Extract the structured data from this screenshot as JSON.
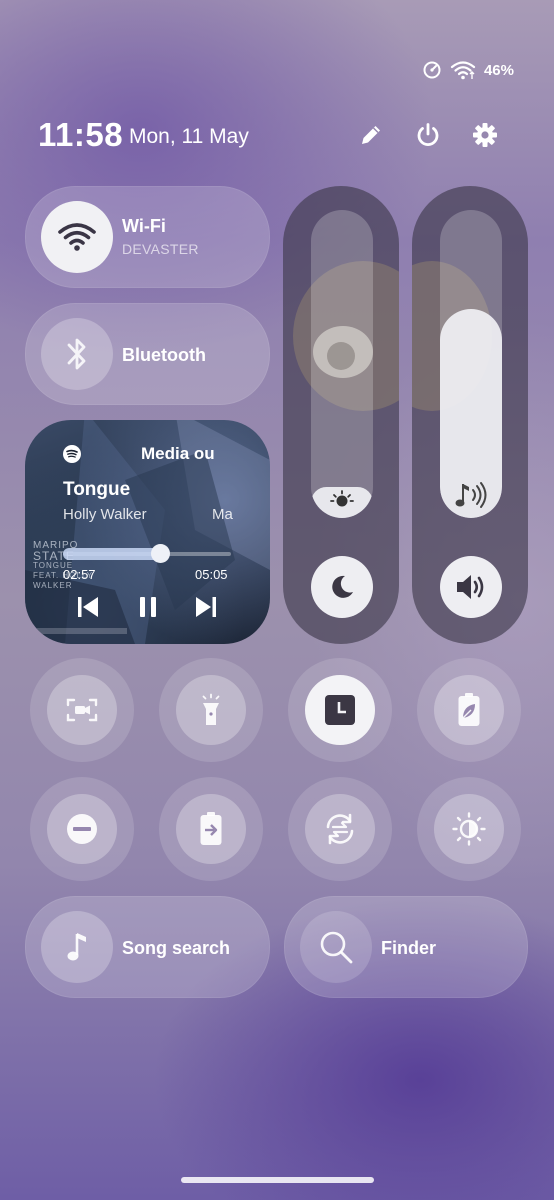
{
  "status_bar": {
    "battery_percent": "46%",
    "icons": [
      "data-saver-icon",
      "wifi-signal-icon"
    ]
  },
  "header": {
    "time": "11:58",
    "date": "Mon, 11 May",
    "icons": [
      "edit-icon",
      "power-icon",
      "settings-icon"
    ]
  },
  "tiles": {
    "wifi": {
      "title": "Wi-Fi",
      "subtitle": "DEVASTER",
      "icon": "wifi-icon",
      "active": true
    },
    "bluetooth": {
      "title": "Bluetooth",
      "icon": "bluetooth-icon",
      "active": false
    },
    "song_search": {
      "title": "Song search",
      "icon": "music-note-icon"
    },
    "finder": {
      "title": "Finder",
      "icon": "search-icon"
    }
  },
  "media": {
    "app_icon": "spotify-icon",
    "output_label": "Media ou",
    "track_title": "Tongue",
    "artist": "Holly Walker",
    "artist_overflow": "Ma",
    "elapsed": "02:57",
    "duration": "05:05",
    "progress": 0.58,
    "art_text": [
      "MARIPO",
      "STATE",
      "TONGUE",
      "FEAT. HOLLY",
      "WALKER"
    ]
  },
  "sliders": {
    "brightness": {
      "level": 0.1,
      "icon": "brightness-icon",
      "button_icon": "night-mode-icon"
    },
    "volume": {
      "level": 0.68,
      "icon": "volume-music-icon",
      "button_icon": "sound-on-icon"
    }
  },
  "quick_toggles": [
    {
      "name": "screen-recorder",
      "icon": "screen-record-icon",
      "active": false
    },
    {
      "name": "flashlight",
      "icon": "flashlight-icon",
      "active": false
    },
    {
      "name": "clock",
      "icon": "clock-icon",
      "active": true
    },
    {
      "name": "power-saving",
      "icon": "battery-leaf-icon",
      "active": false
    },
    {
      "name": "do-not-disturb",
      "icon": "dnd-icon",
      "active": false
    },
    {
      "name": "power-share",
      "icon": "battery-share-icon",
      "active": false
    },
    {
      "name": "auto-rotate",
      "icon": "rotate-icon",
      "active": false
    },
    {
      "name": "eye-comfort",
      "icon": "sun-dim-icon",
      "active": false
    }
  ]
}
